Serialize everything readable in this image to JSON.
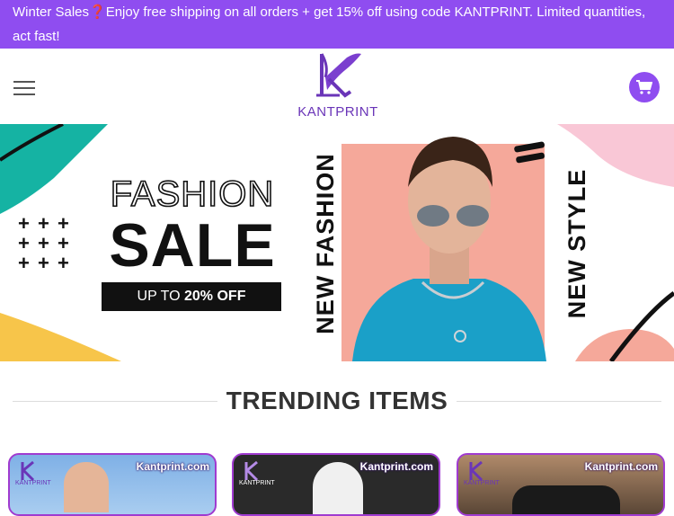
{
  "promo": {
    "text": "Winter Sales❓Enjoy free shipping on all orders + get 15% off using code KANTPRINT. Limited quantities, act fast!"
  },
  "header": {
    "logo_text": "KANTPRINT",
    "menu_icon": "hamburger-menu-icon",
    "cart_icon": "shopping-cart-icon"
  },
  "banner": {
    "headline_outline": "FASHION",
    "headline_main": "SALE",
    "offer_prefix": "UP TO ",
    "offer_value": "20% OFF",
    "vertical_left": "NEW FASHION",
    "vertical_right": "NEW STYLE",
    "plus_marks": [
      "+",
      "+",
      "+",
      "+",
      "+",
      "+",
      "+",
      "+",
      "+"
    ]
  },
  "section": {
    "title": "TRENDING ITEMS"
  },
  "cards": [
    {
      "brand": "Kantprint.com",
      "logo_text": "KANTPRINT"
    },
    {
      "brand": "Kantprint.com",
      "logo_text": "KANTPRINT"
    },
    {
      "brand": "Kantprint.com",
      "logo_text": "KANTPRINT"
    }
  ],
  "colors": {
    "brand_purple": "#8f4df0",
    "logo_purple": "#6a35b8",
    "teal": "#15b3a3",
    "pink": "#f5a89a",
    "yellow": "#f7c54a",
    "shirt_blue": "#1aa0c8"
  }
}
